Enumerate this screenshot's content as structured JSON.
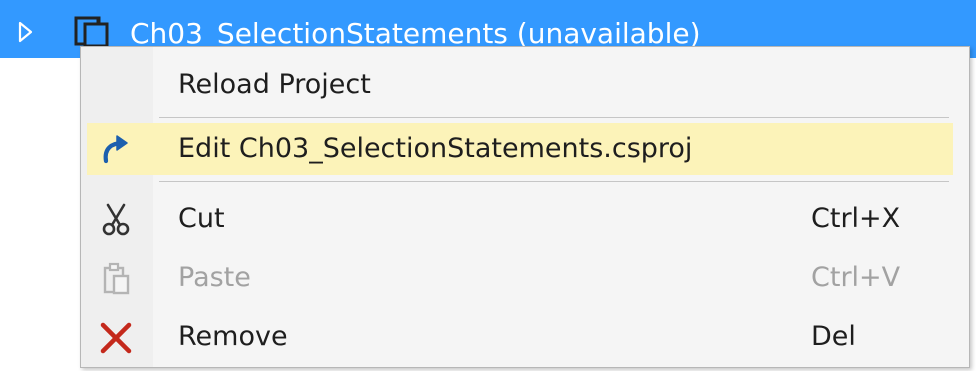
{
  "tree": {
    "project_label": "Ch03_SelectionStatements (unavailable)",
    "icons": {
      "expander": "expand-triangle-icon",
      "project": "project-icon"
    }
  },
  "context_menu": {
    "items": [
      {
        "label": "Reload Project",
        "shortcut": "",
        "icon": "",
        "state": "normal"
      },
      {
        "label": "Edit Ch03_SelectionStatements.csproj",
        "shortcut": "",
        "icon": "edit-arrow-icon",
        "state": "highlighted"
      },
      {
        "label": "Cut",
        "shortcut": "Ctrl+X",
        "icon": "scissors-icon",
        "state": "normal"
      },
      {
        "label": "Paste",
        "shortcut": "Ctrl+V",
        "icon": "paste-icon",
        "state": "disabled"
      },
      {
        "label": "Remove",
        "shortcut": "Del",
        "icon": "remove-x-icon",
        "state": "normal"
      }
    ]
  },
  "colors": {
    "selection": "#3399ff",
    "menu_background": "#f5f5f5",
    "highlight": "#fcf3b9",
    "edit_icon": "#1c5fae",
    "remove_icon": "#c4291c",
    "disabled_text": "#a2a2a2"
  }
}
